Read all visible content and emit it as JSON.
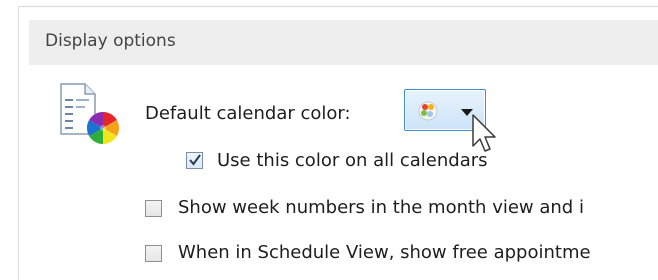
{
  "section": {
    "title": "Display options"
  },
  "calendar_color": {
    "label": "Default calendar color:",
    "icon": "calendar-color-icon",
    "button_icon": "color-palette-icon",
    "accent": "#3c8fd6"
  },
  "options": {
    "all_calendars": {
      "label": "Use this color on all calendars",
      "checked": true
    },
    "week_numbers": {
      "label": "Show week numbers in the month view and i",
      "checked": false
    },
    "schedule_view": {
      "label": "When in Schedule View, show free appointme",
      "checked": false
    }
  }
}
